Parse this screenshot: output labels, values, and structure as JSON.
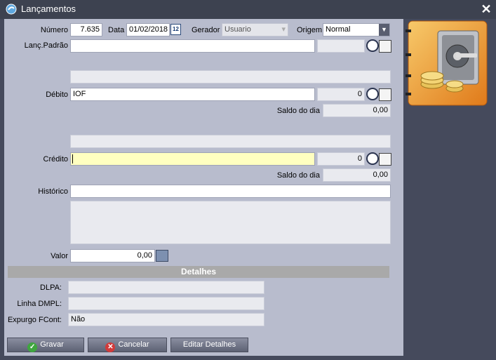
{
  "window": {
    "title": "Lançamentos"
  },
  "fields": {
    "numero": {
      "label": "Número",
      "value": "7.635"
    },
    "data": {
      "label": "Data",
      "value": "01/02/2018",
      "calendar_day": "12"
    },
    "gerador": {
      "label": "Gerador",
      "value": "Usuario"
    },
    "origem": {
      "label": "Origem",
      "value": "Normal"
    },
    "lanc_padrao": {
      "label": "Lanç.Padrão",
      "value": ""
    },
    "debito": {
      "label": "Débito",
      "value": "IOF",
      "code": "0",
      "saldo_label": "Saldo do dia",
      "saldo_value": "0,00"
    },
    "credito": {
      "label": "Crédito",
      "value": "",
      "code": "0",
      "saldo_label": "Saldo do dia",
      "saldo_value": "0,00"
    },
    "historico": {
      "label": "Histórico",
      "value": ""
    },
    "valor": {
      "label": "Valor",
      "value": "0,00"
    }
  },
  "detalhes": {
    "title": "Detalhes",
    "dlpa": {
      "label": "DLPA:",
      "value": ""
    },
    "linha_dmpl": {
      "label": "Linha DMPL:",
      "value": ""
    },
    "expurgo": {
      "label": "Expurgo FCont:",
      "value": "Não"
    }
  },
  "buttons": {
    "gravar": "Gravar",
    "cancelar": "Cancelar",
    "editar_detalhes": "Editar Detalhes"
  },
  "colors": {
    "title_bg": "#3d4250",
    "form_bg": "#b8bccd",
    "focus_field": "#ffffc0"
  },
  "icons": [
    "app-icon",
    "close-icon",
    "calendar-icon",
    "dropdown-arrow-icon",
    "search-icon",
    "list-icon",
    "check-icon",
    "cancel-icon",
    "vault-icon"
  ]
}
